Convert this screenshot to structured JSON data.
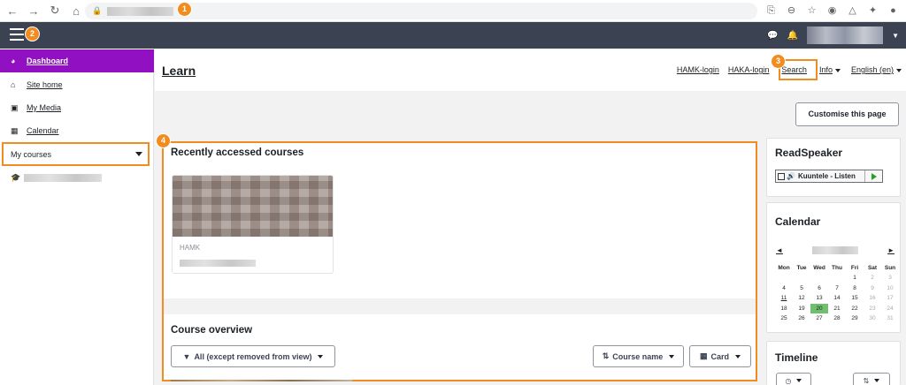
{
  "browser": {
    "badge": "1",
    "back_icon": "arrow-left-icon",
    "forward_icon": "arrow-right-icon",
    "reload_icon": "reload-icon",
    "home_icon": "home-icon"
  },
  "navbar": {
    "menu_badge": "2"
  },
  "drawer": {
    "items": [
      {
        "label": "Dashboard",
        "icon": "dashboard-icon"
      },
      {
        "label": "Site home",
        "icon": "home-icon"
      },
      {
        "label": "My Media",
        "icon": "media-icon"
      },
      {
        "label": "Calendar",
        "icon": "calendar-icon"
      }
    ],
    "my_courses": "My courses"
  },
  "header": {
    "title": "Learn",
    "links": {
      "hamk_login": "HAMK-login",
      "haka_login": "HAKA-login",
      "search": "Search",
      "info": "Info",
      "language": "English (en)"
    },
    "search_badge": "3"
  },
  "customise_label": "Customise this page",
  "main": {
    "badge": "4",
    "recent_title": "Recently accessed courses",
    "course_category": "HAMK",
    "overview_title": "Course overview",
    "filter_label": "All (except removed from view)",
    "sort_label": "Course name",
    "view_label": "Card"
  },
  "readspeaker": {
    "title": "ReadSpeaker",
    "button_label": "Kuuntele - Listen"
  },
  "calendar": {
    "title": "Calendar",
    "prev": "◄",
    "next": "►",
    "weekdays": [
      "Mon",
      "Tue",
      "Wed",
      "Thu",
      "Fri",
      "Sat",
      "Sun"
    ],
    "weeks": [
      [
        "",
        "",
        "",
        "",
        "1",
        "2",
        "3"
      ],
      [
        "4",
        "5",
        "6",
        "7",
        "8",
        "9",
        "10"
      ],
      [
        "11",
        "12",
        "13",
        "14",
        "15",
        "16",
        "17"
      ],
      [
        "18",
        "19",
        "20",
        "21",
        "22",
        "23",
        "24"
      ],
      [
        "25",
        "26",
        "27",
        "28",
        "29",
        "30",
        "31"
      ]
    ],
    "today": "20",
    "event_day": "11"
  },
  "timeline": {
    "title": "Timeline"
  },
  "colors": {
    "accent": "#9010c2",
    "highlight": "#f28c1e",
    "navbar": "#3b4353"
  }
}
